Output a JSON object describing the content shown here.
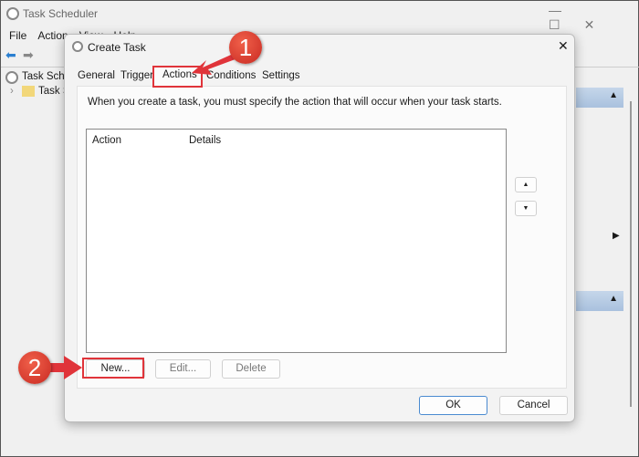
{
  "main_window": {
    "title": "Task Scheduler",
    "menu": [
      "File",
      "Action",
      "View",
      "Help"
    ],
    "tree": [
      "Task Scheduler (Local)",
      "Task Scheduler Library"
    ]
  },
  "dialog": {
    "title": "Create Task",
    "tabs": [
      "General",
      "Triggers",
      "Actions",
      "Conditions",
      "Settings"
    ],
    "active_tab": "Actions",
    "instruction": "When you create a task, you must specify the action that will occur when your task starts.",
    "columns": [
      "Action",
      "Details"
    ],
    "rows": [],
    "buttons": {
      "new": "New...",
      "edit": "Edit...",
      "delete": "Delete",
      "ok": "OK",
      "cancel": "Cancel"
    }
  },
  "annotations": {
    "step1": "1",
    "step2": "2",
    "color": "#e0343a"
  }
}
